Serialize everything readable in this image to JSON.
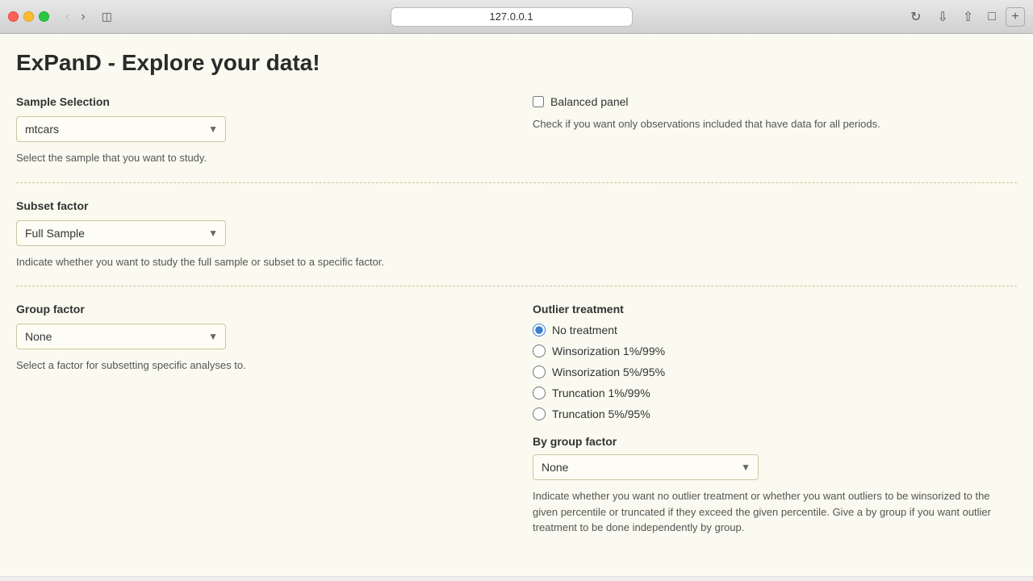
{
  "browser": {
    "url": "127.0.0.1",
    "back_disabled": true,
    "forward_disabled": false
  },
  "page": {
    "title": "ExPanD - Explore your data!"
  },
  "sample_selection": {
    "label": "Sample Selection",
    "selected": "mtcars",
    "options": [
      "mtcars"
    ],
    "description": "Select the sample that you want to study."
  },
  "balanced_panel": {
    "label": "Balanced panel",
    "checked": false,
    "description": "Check if you want only observations included that have data for all periods."
  },
  "subset_factor": {
    "label": "Subset factor",
    "selected": "Full Sample",
    "options": [
      "Full Sample"
    ],
    "description": "Indicate whether you want to study the full sample or subset to a specific factor."
  },
  "group_factor": {
    "label": "Group factor",
    "selected": "None",
    "options": [
      "None"
    ],
    "description": "Select a factor for subsetting specific analyses to."
  },
  "outlier_treatment": {
    "label": "Outlier treatment",
    "options": [
      {
        "value": "no_treatment",
        "label": "No treatment",
        "checked": true
      },
      {
        "value": "winsorization_1_99",
        "label": "Winsorization 1%/99%",
        "checked": false
      },
      {
        "value": "winsorization_5_95",
        "label": "Winsorization 5%/95%",
        "checked": false
      },
      {
        "value": "truncation_1_99",
        "label": "Truncation 1%/99%",
        "checked": false
      },
      {
        "value": "truncation_5_95",
        "label": "Truncation 5%/95%",
        "checked": false
      }
    ]
  },
  "by_group_factor": {
    "label": "By group factor",
    "selected": "None",
    "options": [
      "None"
    ],
    "description": "Indicate whether you want no outlier treatment or whether you want outliers to be winsorized to the given percentile or truncated if they exceed the given percentile. Give a by group if you want outlier treatment to be done independently by group."
  }
}
